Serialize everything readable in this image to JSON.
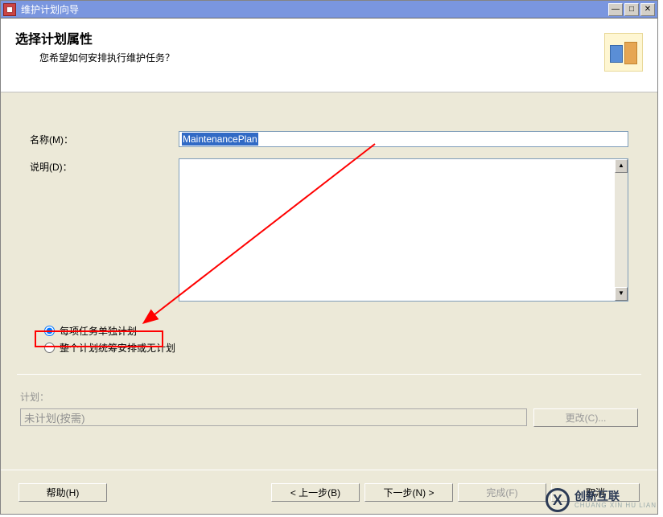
{
  "window": {
    "title": "维护计划向导"
  },
  "header": {
    "title": "选择计划属性",
    "subtitle": "您希望如何安排执行维护任务？"
  },
  "form": {
    "name_label": "名称(M)：",
    "name_value": "MaintenancePlan",
    "desc_label": "说明(D)：",
    "desc_value": ""
  },
  "radios": {
    "option1": "每项任务单独计划",
    "option2": "整个计划统筹安排或无计划",
    "selected": "option1"
  },
  "schedule": {
    "label": "计划：",
    "value": "未计划(按需)",
    "change_btn": "更改(C)..."
  },
  "footer": {
    "help": "帮助(H)",
    "back": "< 上一步(B)",
    "next": "下一步(N) >",
    "finish": "完成(F)",
    "cancel": "取消"
  },
  "watermark": {
    "cn": "创新互联",
    "en": "CHUANG XIN HU LIAN"
  }
}
